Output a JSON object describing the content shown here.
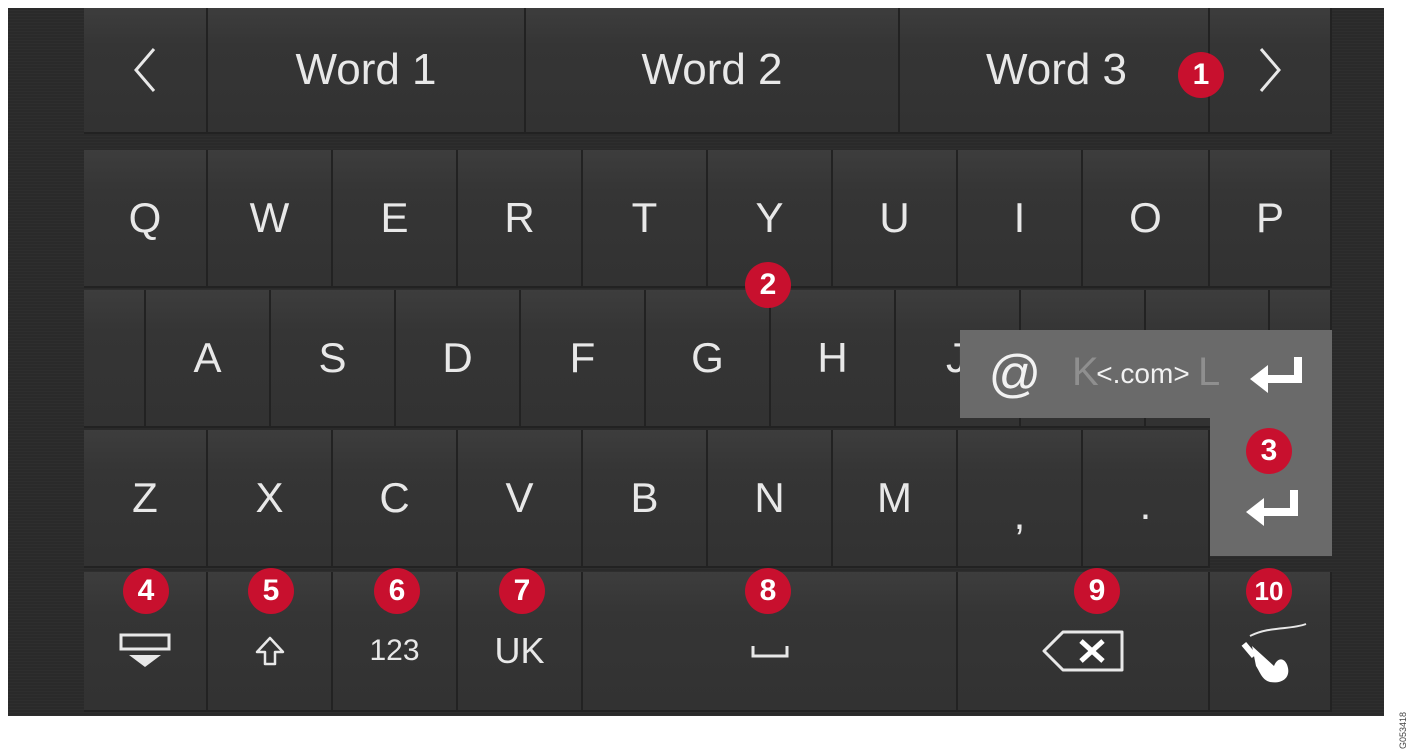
{
  "suggestions": {
    "prev_icon": "chevron-left",
    "next_icon": "chevron-right",
    "words": [
      "Word 1",
      "Word 2",
      "Word 3"
    ]
  },
  "rows": {
    "row1": [
      "Q",
      "W",
      "E",
      "R",
      "T",
      "Y",
      "U",
      "I",
      "O",
      "P"
    ],
    "row2": [
      "A",
      "S",
      "D",
      "F",
      "G",
      "H",
      "J"
    ],
    "row2_hidden": [
      "K",
      "L"
    ],
    "row3": [
      "Z",
      "X",
      "C",
      "V",
      "B",
      "N",
      "M",
      ",",
      "."
    ]
  },
  "popup": {
    "at": "@",
    "com": "<.com>",
    "enter_icon": "enter-icon"
  },
  "bottom_row": {
    "hide_icon": "keyboard-hide-icon",
    "shift_icon": "shift-icon",
    "numbers": "123",
    "language": "UK",
    "space_icon": "space-icon",
    "backspace_icon": "backspace-icon",
    "handwriting_icon": "handwriting-icon"
  },
  "badges": [
    "1",
    "2",
    "3",
    "4",
    "5",
    "6",
    "7",
    "8",
    "9",
    "10"
  ],
  "figure_id": "G053418",
  "colors": {
    "badge": "#c8102e",
    "popup": "#6a6a6a",
    "background": "#2a2a2a",
    "key_text": "#e8e8e8"
  }
}
